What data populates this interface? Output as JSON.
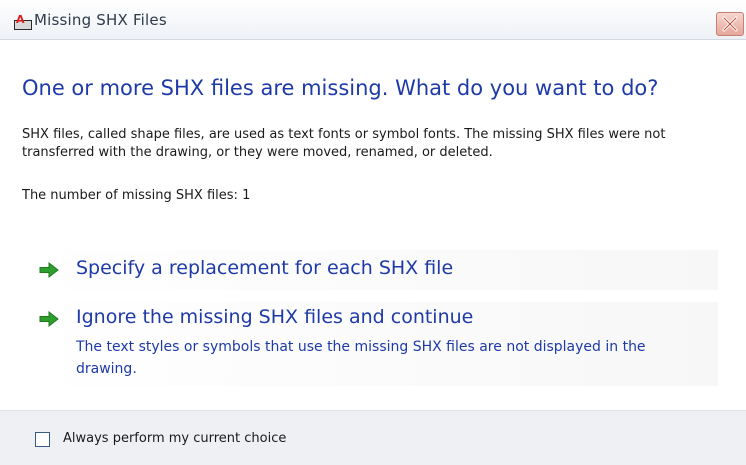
{
  "window": {
    "title": "Missing SHX Files",
    "app_icon": "autocad-a-icon",
    "close_icon": "close-x-icon"
  },
  "main": {
    "heading": "One or more SHX files are missing. What do you want to do?",
    "description": "SHX files, called shape files, are used as text fonts or symbol fonts. The missing SHX files were not transferred with the drawing, or they were moved, renamed, or deleted.",
    "count_label": "The number of missing SHX files:",
    "count_value": "1"
  },
  "options": [
    {
      "icon": "green-arrow-icon",
      "label": "Specify a replacement for each SHX file"
    },
    {
      "icon": "green-arrow-icon",
      "label": "Ignore the missing SHX files and continue",
      "description": "The text styles or symbols that use the missing SHX files are not displayed in the drawing."
    }
  ],
  "footer": {
    "checkbox_label": "Always perform my current choice",
    "checkbox_checked": false
  },
  "colors": {
    "heading": "#1e3aa8",
    "arrow": "#2e9e2e",
    "close_button": "#e6a79a",
    "footer_bg": "#eef0f3"
  }
}
